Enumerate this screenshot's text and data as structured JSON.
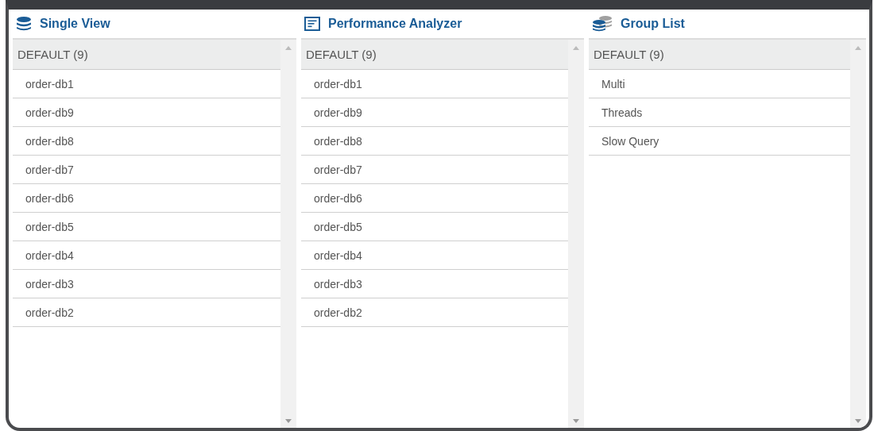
{
  "panels": [
    {
      "kind": "single",
      "title": "Single View",
      "group": "DEFAULT (9)",
      "items": [
        "order-db1",
        "order-db9",
        "order-db8",
        "order-db7",
        "order-db6",
        "order-db5",
        "order-db4",
        "order-db3",
        "order-db2"
      ]
    },
    {
      "kind": "analyzer",
      "title": "Performance Analyzer",
      "group": "DEFAULT (9)",
      "items": [
        "order-db1",
        "order-db9",
        "order-db8",
        "order-db7",
        "order-db6",
        "order-db5",
        "order-db4",
        "order-db3",
        "order-db2"
      ]
    },
    {
      "kind": "group",
      "title": "Group List",
      "group": "DEFAULT (9)",
      "items": [
        "Multi",
        "Threads",
        "Slow Query"
      ]
    }
  ]
}
